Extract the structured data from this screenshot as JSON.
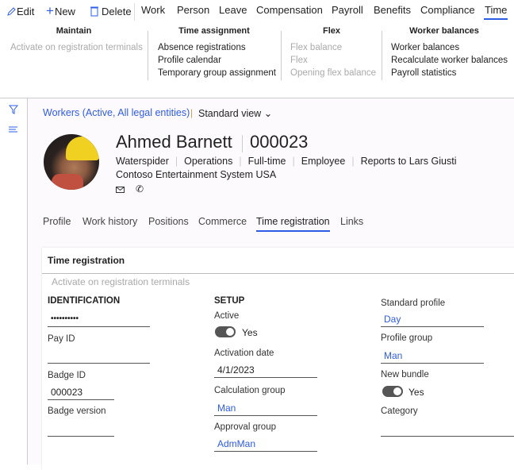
{
  "commands": {
    "edit": "Edit",
    "new": "New",
    "delete": "Delete"
  },
  "tabs": [
    "Work",
    "Person",
    "Leave",
    "Compensation",
    "Payroll",
    "Benefits",
    "Compliance",
    "Time"
  ],
  "active_tab": "Time",
  "ribbon": {
    "maintain": {
      "title": "Maintain",
      "items": [
        "Activate on registration terminals"
      ]
    },
    "time_assignment": {
      "title": "Time assignment",
      "items": [
        "Absence registrations",
        "Profile calendar",
        "Temporary group assignment"
      ]
    },
    "flex": {
      "title": "Flex",
      "items": [
        "Flex balance",
        "Flex",
        "Opening flex balance"
      ]
    },
    "worker_balances": {
      "title": "Worker balances",
      "items": [
        "Worker balances",
        "Recalculate worker balances",
        "Payroll statistics"
      ]
    }
  },
  "breadcrumb": {
    "link": "Workers (Active, All legal entities)",
    "view": "Standard view"
  },
  "worker": {
    "name": "Ahmed Barnett",
    "id": "000023",
    "details": [
      "Waterspider",
      "Operations",
      "Full-time",
      "Employee",
      "Reports to Lars Giusti"
    ],
    "company": "Contoso Entertainment System USA"
  },
  "detail_tabs": [
    "Profile",
    "Work history",
    "Positions",
    "Commerce",
    "Time registration",
    "Links"
  ],
  "card": {
    "title": "Time registration",
    "action": "Activate on registration terminals",
    "identification": {
      "heading": "IDENTIFICATION",
      "password": "••••••••••",
      "pay_id_label": "Pay ID",
      "pay_id": "",
      "badge_id_label": "Badge ID",
      "badge_id": "000023",
      "badge_version_label": "Badge version",
      "badge_version": ""
    },
    "setup": {
      "heading": "SETUP",
      "active_label": "Active",
      "active": "Yes",
      "activation_date_label": "Activation date",
      "activation_date": "4/1/2023",
      "calc_group_label": "Calculation group",
      "calc_group": "Man",
      "approval_group_label": "Approval group",
      "approval_group": "AdmMan"
    },
    "profile": {
      "standard_profile_label": "Standard profile",
      "standard_profile": "Day",
      "profile_group_label": "Profile group",
      "profile_group": "Man",
      "new_bundle_label": "New bundle",
      "new_bundle": "Yes",
      "category_label": "Category",
      "category": ""
    }
  },
  "colors": {
    "accent": "#2e5ce6",
    "toggle_on": "#555555"
  }
}
